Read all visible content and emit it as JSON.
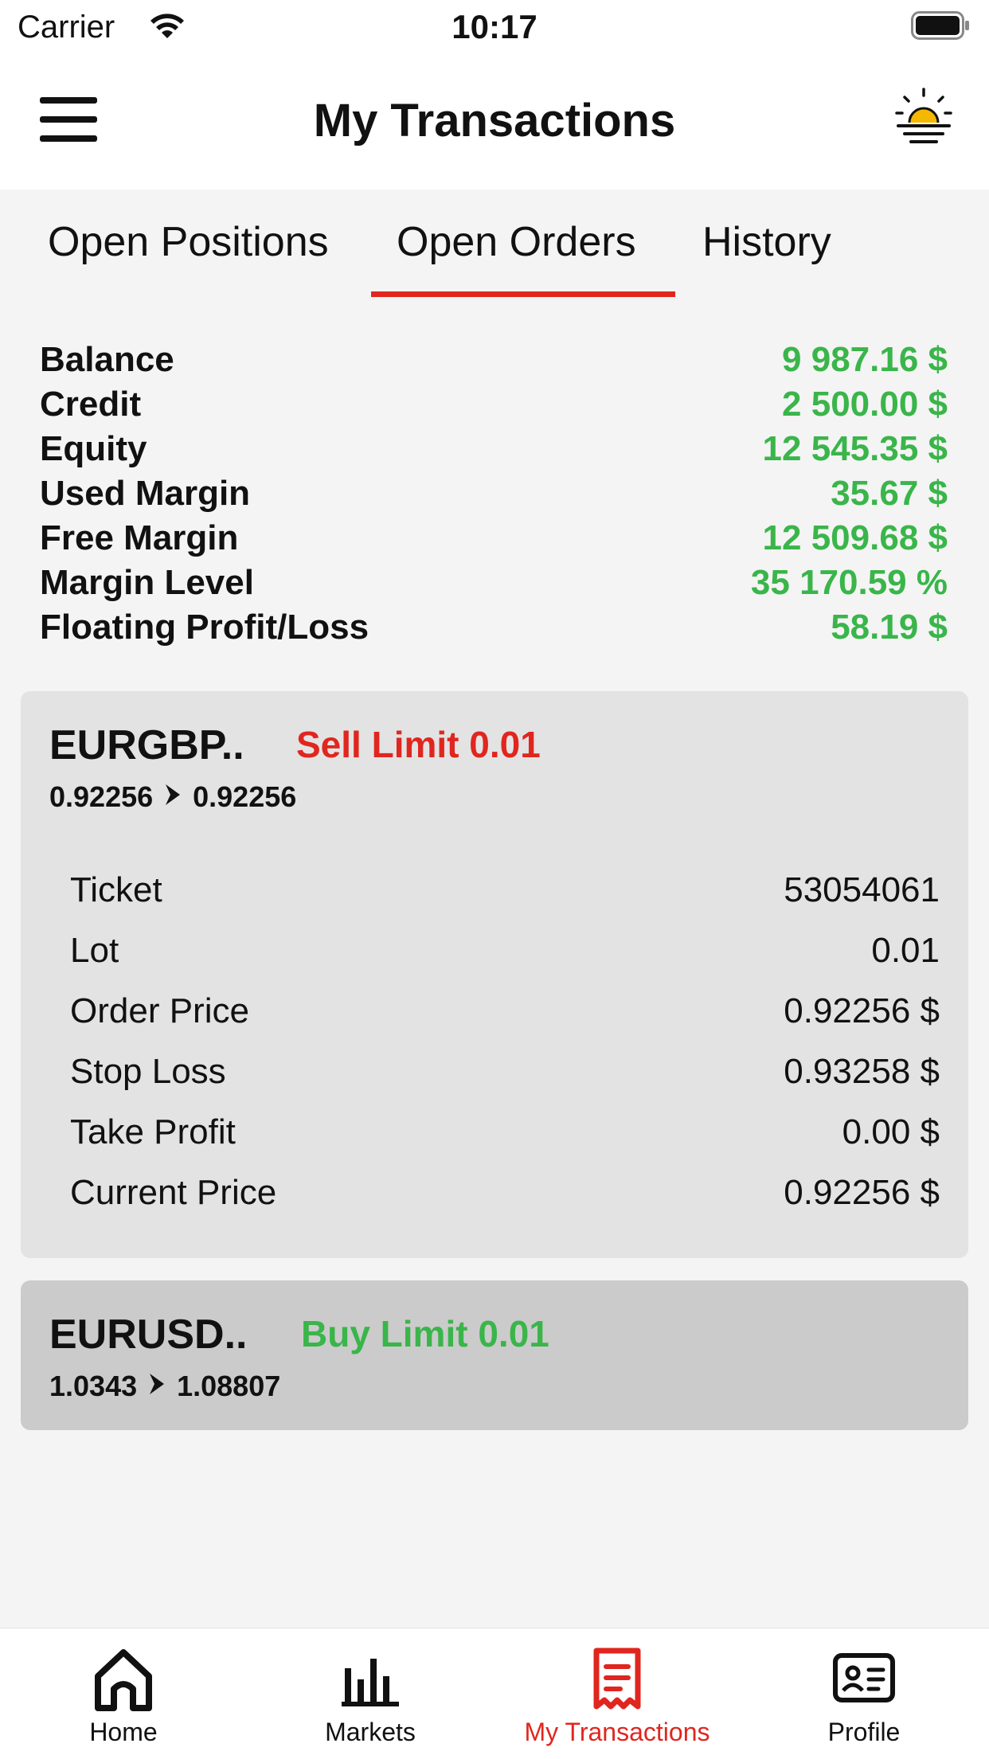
{
  "status": {
    "carrier": "Carrier",
    "time": "10:17"
  },
  "header": {
    "title": "My Transactions"
  },
  "tabs": [
    {
      "label": "Open Positions",
      "active": false
    },
    {
      "label": "Open Orders",
      "active": true
    },
    {
      "label": "History",
      "active": false
    }
  ],
  "summary": [
    {
      "label": "Balance",
      "value": "9 987.16 $"
    },
    {
      "label": "Credit",
      "value": "2 500.00 $"
    },
    {
      "label": "Equity",
      "value": "12 545.35 $"
    },
    {
      "label": "Used Margin",
      "value": "35.67 $"
    },
    {
      "label": "Free Margin",
      "value": "12 509.68 $"
    },
    {
      "label": "Margin Level",
      "value": "35 170.59 %"
    },
    {
      "label": "Floating Profit/Loss",
      "value": "58.19 $"
    }
  ],
  "orders": [
    {
      "symbol": "EURGBP..",
      "type": "Sell Limit 0.01",
      "type_color": "#e0261e",
      "price_from": "0.92256",
      "price_to": "0.92256",
      "details": [
        {
          "label": "Ticket",
          "value": "53054061"
        },
        {
          "label": "Lot",
          "value": "0.01"
        },
        {
          "label": "Order Price",
          "value": "0.92256 $"
        },
        {
          "label": "Stop Loss",
          "value": "0.93258 $"
        },
        {
          "label": "Take Profit",
          "value": "0.00 $"
        },
        {
          "label": "Current Price",
          "value": "0.92256 $"
        }
      ]
    },
    {
      "symbol": "EURUSD..",
      "type": "Buy Limit 0.01",
      "type_color": "#3ab54a",
      "price_from": "1.0343",
      "price_to": "1.08807"
    }
  ],
  "tabbar": [
    {
      "label": "Home",
      "icon": "home-icon",
      "active": false
    },
    {
      "label": "Markets",
      "icon": "bar-chart-icon",
      "active": false
    },
    {
      "label": "My Transactions",
      "icon": "receipt-icon",
      "active": true
    },
    {
      "label": "Profile",
      "icon": "id-card-icon",
      "active": false
    }
  ],
  "colors": {
    "accent": "#e0261e",
    "positive": "#3ab54a",
    "sun": "#f5b800"
  }
}
